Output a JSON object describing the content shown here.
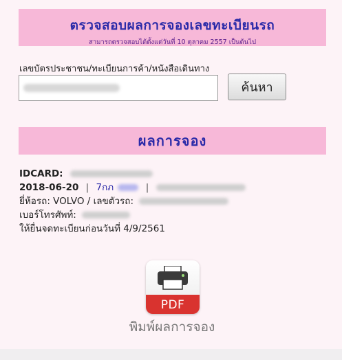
{
  "header": {
    "title": "ตรวจสอบผลการจองเลขทะเบียนรถ",
    "subtitle": "สามารถตรวจสอบได้ตั้งแต่วันที่ 10 ตุลาคม 2557 เป็นต้นไป"
  },
  "search": {
    "label": "เลขบัตรประชาชน/ทะเบียนการค้า/หนังสือเดินทาง",
    "button_label": "ค้นหา"
  },
  "result": {
    "title": "ผลการจอง",
    "idcard_label": "IDCARD:",
    "date": "2018-06-20",
    "separator": "|",
    "plate_prefix": "7กภ",
    "vehicle_line": "ยี่ห้อรถ: VOLVO / เลขตัวรถ:",
    "phone_line": "เบอร์โทรศัพท์:",
    "deadline_line": "ให้ยื่นจดทะเบียนก่อนวันที่ 4/9/2561"
  },
  "print": {
    "icon_text": "PDF",
    "label": "พิมพ์ผลการจอง"
  }
}
